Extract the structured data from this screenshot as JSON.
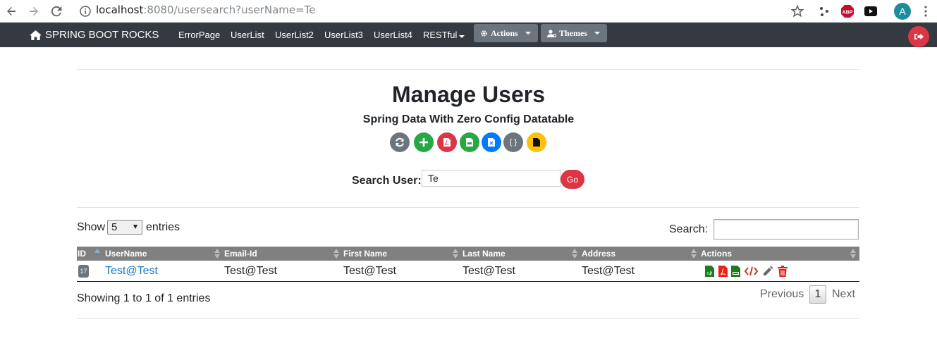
{
  "browser": {
    "url_host": "localhost",
    "url_rest": ":8080/usersearch?userName=Te",
    "profile_initial": "A",
    "abp_label": "ABP"
  },
  "navbar": {
    "brand": "SPRING BOOT ROCKS",
    "links": [
      "ErrorPage",
      "UserList",
      "UserList2",
      "UserList3",
      "UserList4",
      "RESTful"
    ],
    "actions_label": "Actions",
    "themes_label": "Themes"
  },
  "page": {
    "title": "Manage Users",
    "subtitle": "Spring Data With Zero Config Datatable",
    "search_label": "Search User:",
    "search_value": "Te",
    "go_label": "Go",
    "toolbar_json_glyph": "{ }"
  },
  "colors": {
    "navbar_bg": "#343a40",
    "danger": "#dc3545",
    "success": "#28a745",
    "primary": "#007bff",
    "secondary": "#6c757d",
    "warning": "#ffc107",
    "link": "#1a73c8"
  },
  "table": {
    "show_label": "Show",
    "length_value": "5",
    "entries_label": "entries",
    "filter_label": "Search:",
    "columns": [
      "ID",
      "UserName",
      "Email-Id",
      "First Name",
      "Last Name",
      "Address",
      "Actions"
    ],
    "rows": [
      {
        "id": "17",
        "username": "Test@Test",
        "email": "Test@Test",
        "first_name": "Test@Test",
        "last_name": "Test@Test",
        "address": "Test@Test"
      }
    ],
    "info": "Showing 1 to 1 of 1 entries",
    "pagination": {
      "previous": "Previous",
      "current": "1",
      "next": "Next"
    }
  }
}
